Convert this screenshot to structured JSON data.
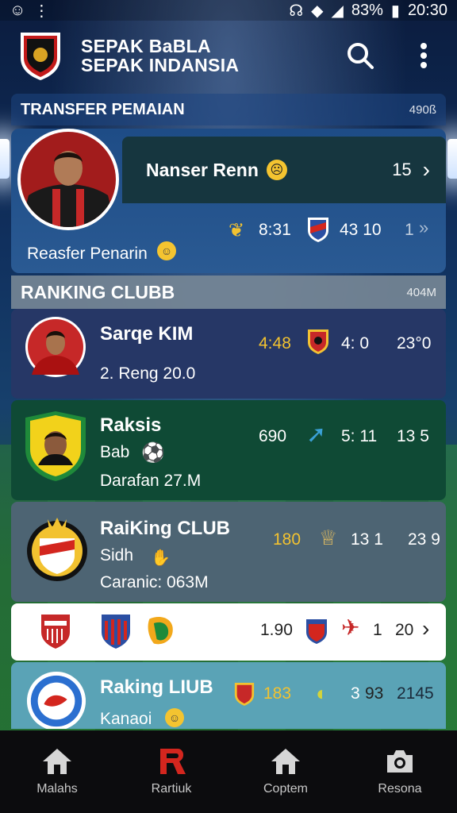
{
  "status_bar": {
    "battery": "83%",
    "time": "20:30"
  },
  "app": {
    "title_line1": "SEPAK BaBLA",
    "title_line2": "SEPAK INDANSIA"
  },
  "transfer": {
    "header": "TRANSFER PEMAIAN",
    "header_meta": "490ß",
    "player_name": "Nanser Renn",
    "count": "15",
    "time": "8:31",
    "score": "43 10",
    "extra": "1",
    "caption": "Reasfer Penarin"
  },
  "ranking": {
    "header": "RANKING CLUBB",
    "header_meta": "404M",
    "rows": [
      {
        "name": "Sarqe KIM",
        "sub": "2. Reng 20.0",
        "value": "4:48",
        "score": "4: 0",
        "total": "23°0"
      },
      {
        "name": "Raksis",
        "sub": "Bab",
        "sub2": "Darafan 27.M",
        "value": "690",
        "score": "5: 11",
        "total": "13 5"
      },
      {
        "name": "RaiKing CLUB",
        "sub": "Sidh",
        "sub2": "Caranic: 063M",
        "value": "180",
        "score": "13 1",
        "total": "23 9"
      },
      {
        "value": "1.90",
        "score": "1",
        "total": "20"
      },
      {
        "name": "Raking LIUB",
        "sub": "Kanaoi",
        "value": "183",
        "score": "3",
        "score2": "93",
        "total": "2145"
      }
    ]
  },
  "nav": [
    {
      "label": "Malahs",
      "icon": "home-icon"
    },
    {
      "label": "Rartiuk",
      "icon": "r-icon"
    },
    {
      "label": "Coptem",
      "icon": "home-icon"
    },
    {
      "label": "Resona",
      "icon": "camera-icon"
    }
  ],
  "colors": {
    "accent_red": "#d3261e",
    "row1": "#263766",
    "row2": "#0f4a35",
    "row3": "#4d6473",
    "row4": "#ffffff",
    "row5": "#5aa3b6"
  }
}
